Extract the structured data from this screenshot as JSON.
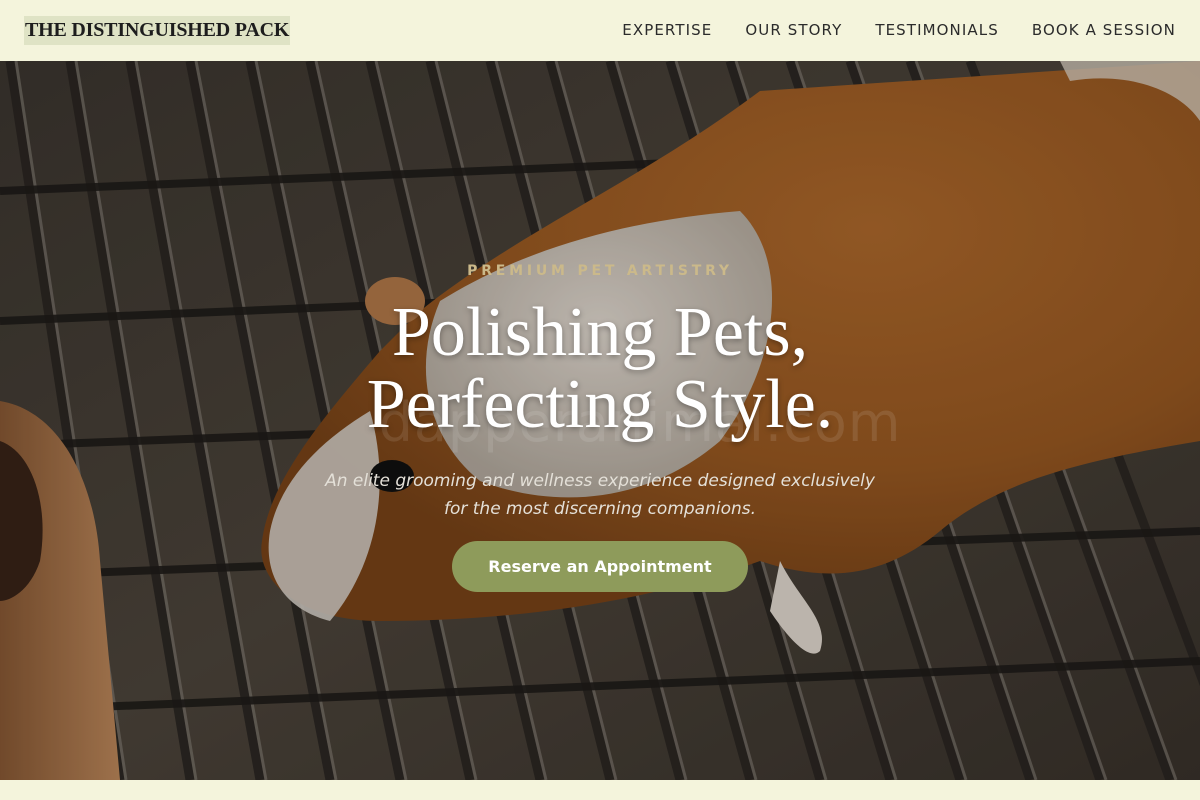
{
  "header": {
    "brand": "THE DISTINGUISHED PACK",
    "nav": [
      {
        "label": "EXPERTISE"
      },
      {
        "label": "OUR STORY"
      },
      {
        "label": "TESTIMONIALS"
      },
      {
        "label": "BOOK A SESSION"
      }
    ]
  },
  "hero": {
    "eyebrow": "PREMIUM PET ARTISTRY",
    "headline_line1": "Polishing Pets,",
    "headline_line2": "Perfecting Style.",
    "watermark": "dapperanimal.com",
    "subtitle_line1": "An elite grooming and wellness experience designed exclusively",
    "subtitle_line2": "for the most discerning companions.",
    "cta_label": "Reserve an Appointment",
    "image_subject": "guinea-pig-on-wire-grate"
  },
  "colors": {
    "page_bg": "#f4f4dc",
    "brand_highlight": "#dfe3c5",
    "eyebrow": "#cbb98a",
    "cta_bg": "#8e9b5b",
    "headline": "#ffffff"
  }
}
